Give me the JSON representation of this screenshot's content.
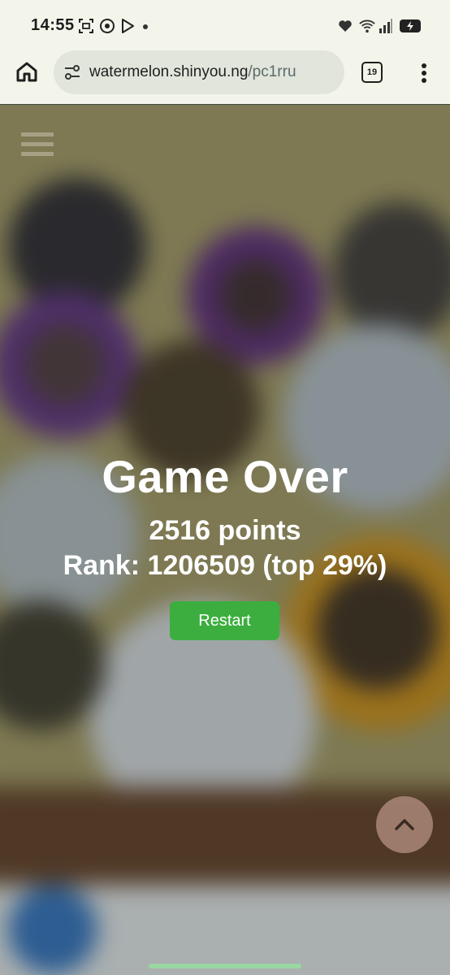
{
  "status_bar": {
    "time": "14:55",
    "icons": [
      "screenshot-icon",
      "recorder-icon",
      "play-icon",
      "notification-dot",
      "heart-icon",
      "wifi-icon",
      "signal-icon",
      "battery-charging-icon"
    ]
  },
  "browser": {
    "url_domain": "watermelon.shinyou.ng",
    "url_path": "/pc1rru",
    "tab_count": "19"
  },
  "game": {
    "title": "Game Over",
    "points": "2516 points",
    "rank": "Rank: 1206509 (top 29%)",
    "restart_label": "Restart"
  },
  "colors": {
    "restart_button": "#3cae3f",
    "text": "#ffffff",
    "scroll_top_button": "#aa8778"
  }
}
